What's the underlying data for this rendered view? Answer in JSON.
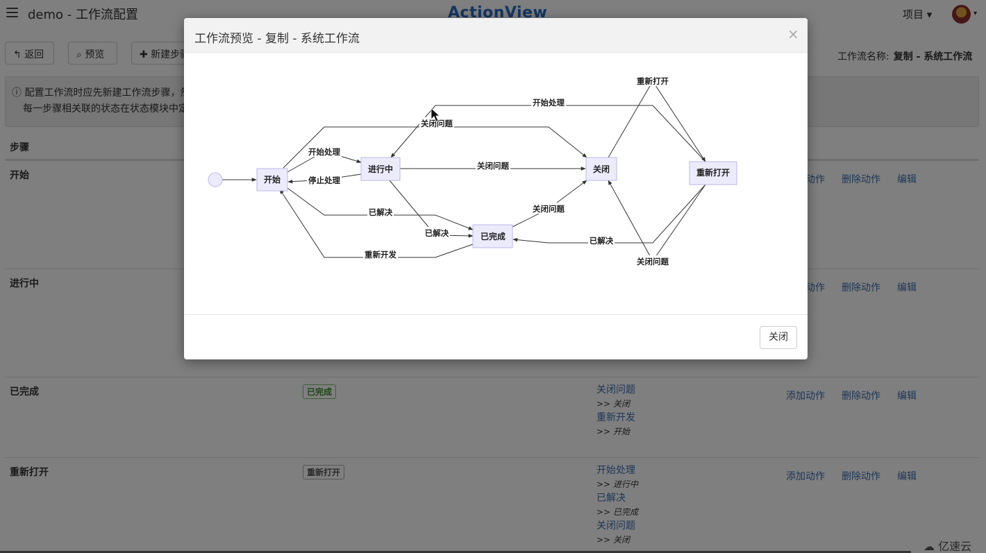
{
  "app": {
    "title": "demo - 工作流配置",
    "brand": "ActionView",
    "project_menu": "项目 ▾"
  },
  "toolbar": {
    "back_label": "返回",
    "preview_label": "预览",
    "new_step_label": "新建步骤",
    "workflow_name_label": "工作流名称:",
    "workflow_name_value": "复制 - 系统工作流"
  },
  "notice": {
    "line1": "配置工作流时应先新建工作流步骤，然",
    "line2": "每一步骤相关联的状态在状态模块中定"
  },
  "table": {
    "header_steps": "步骤",
    "links": {
      "add": "添加动作",
      "delete": "删除动作",
      "edit": "编辑"
    },
    "rows": [
      {
        "name": "开始"
      },
      {
        "name": "进行中"
      },
      {
        "name": "已完成",
        "badge": "已完成",
        "actions": [
          {
            "action": "关闭问题",
            "target": "关闭"
          },
          {
            "action": "重新开发",
            "target": "开始"
          }
        ]
      },
      {
        "name": "重新打开",
        "badge": "重新打开",
        "actions": [
          {
            "action": "开始处理",
            "target": "进行中"
          },
          {
            "action": "已解决",
            "target": "已完成"
          },
          {
            "action": "关闭问题",
            "target": "关闭"
          }
        ]
      }
    ]
  },
  "modal": {
    "title": "工作流预览 - 复制 - 系统工作流",
    "close_x": "×",
    "close_button": "关闭",
    "nodes": {
      "start": "开始",
      "inprogress": "进行中",
      "closed": "关闭",
      "reopened": "重新打开",
      "done": "已完成"
    },
    "edges": {
      "start_to_inprogress": "开始处理",
      "inprogress_to_start": "停止处理",
      "start_to_done": "已解决",
      "done_to_start": "重新开发",
      "inprogress_to_closed": "关闭问题",
      "inprogress_to_done": "已解决",
      "done_to_closed": "关闭问题",
      "start_to_closed_over": "关闭问题",
      "closed_to_reopened": "重新打开",
      "reopened_to_inprogress": "开始处理",
      "reopened_to_done": "已解决",
      "reopened_to_closed": "关闭问题"
    }
  },
  "watermark": "亿速云"
}
